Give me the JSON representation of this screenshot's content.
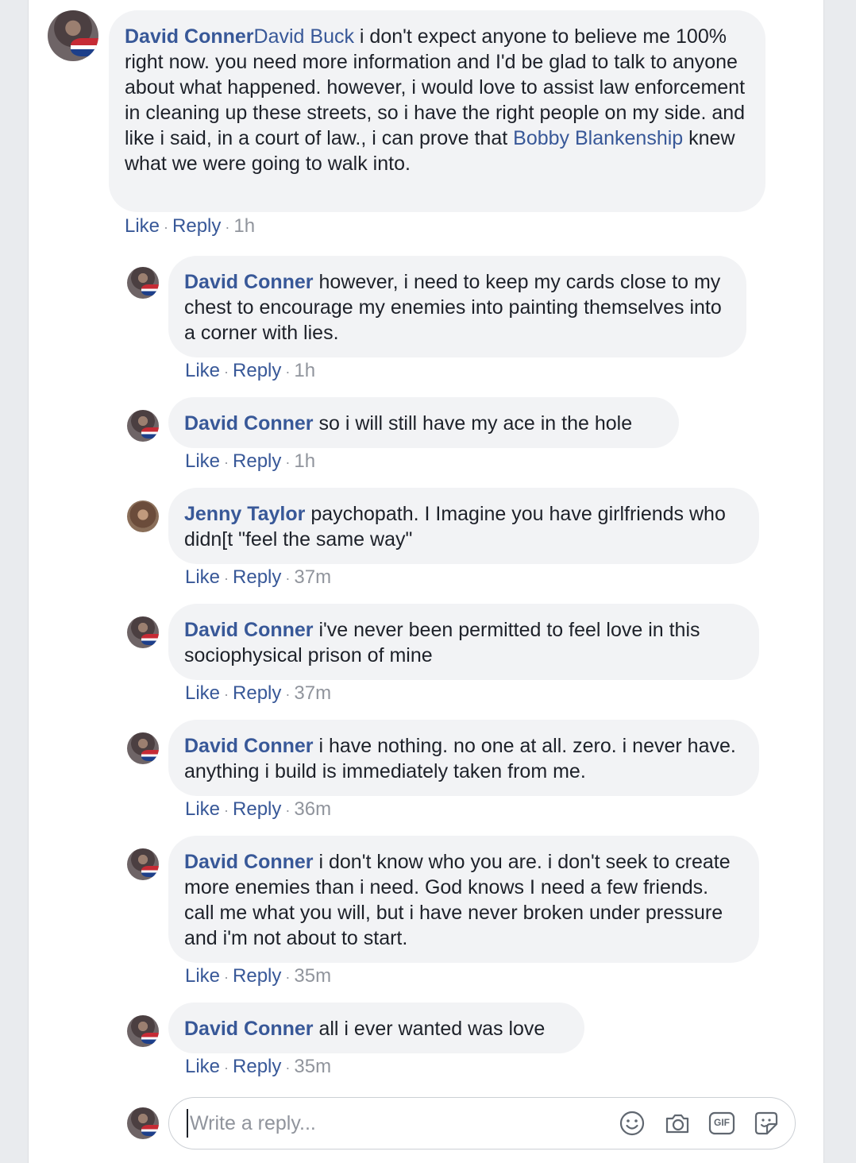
{
  "comment": {
    "author": "David Conner",
    "mention": "David Buck",
    "text_before": " i don't expect anyone to believe me 100% right now. you need more information and I'd be glad to talk to anyone about what happened. however, i would love to assist law enforcement in cleaning up these streets, so i have the right people on my side. and like i said, in a court of law., i can prove that ",
    "mention2": "Bobby Blankenship",
    "text_after": " knew what we were going to walk into.",
    "like": "Like",
    "reply": "Reply",
    "time": "1h"
  },
  "replies": [
    {
      "author": "David Conner",
      "text": " however, i need to keep my cards close to my chest to encourage my enemies into painting themselves into a corner with lies.",
      "like": "Like",
      "reply": "Reply",
      "time": "1h"
    },
    {
      "author": "David Conner",
      "text": " so i will still have my ace in the hole",
      "like": "Like",
      "reply": "Reply",
      "time": "1h"
    },
    {
      "author": "Jenny Taylor",
      "text": " paychopath. I Imagine you have girlfriends who didn[t \"feel the same way\"",
      "like": "Like",
      "reply": "Reply",
      "time": "37m"
    },
    {
      "author": "David Conner",
      "text": " i've never been permitted to feel love in this sociophysical prison of mine",
      "like": "Like",
      "reply": "Reply",
      "time": "37m"
    },
    {
      "author": "David Conner",
      "text": " i have nothing. no one at all. zero. i never have. anything i build is immediately taken from me.",
      "like": "Like",
      "reply": "Reply",
      "time": "36m"
    },
    {
      "author": "David Conner",
      "text": " i don't know who you are. i don't seek to create more enemies than i need. God knows I need a few friends. call me what you will, but i have never broken under pressure and i'm not about to start.",
      "like": "Like",
      "reply": "Reply",
      "time": "35m"
    },
    {
      "author": "David Conner",
      "text": " all i ever wanted was love",
      "like": "Like",
      "reply": "Reply",
      "time": "35m"
    }
  ],
  "composer": {
    "placeholder": "Write a reply...",
    "icons": [
      "emoji-icon",
      "camera-icon",
      "gif-icon",
      "sticker-icon"
    ],
    "gif_label": "GIF"
  },
  "colors": {
    "link": "#385898",
    "bubble": "#f2f3f5",
    "meta": "#90949c"
  }
}
